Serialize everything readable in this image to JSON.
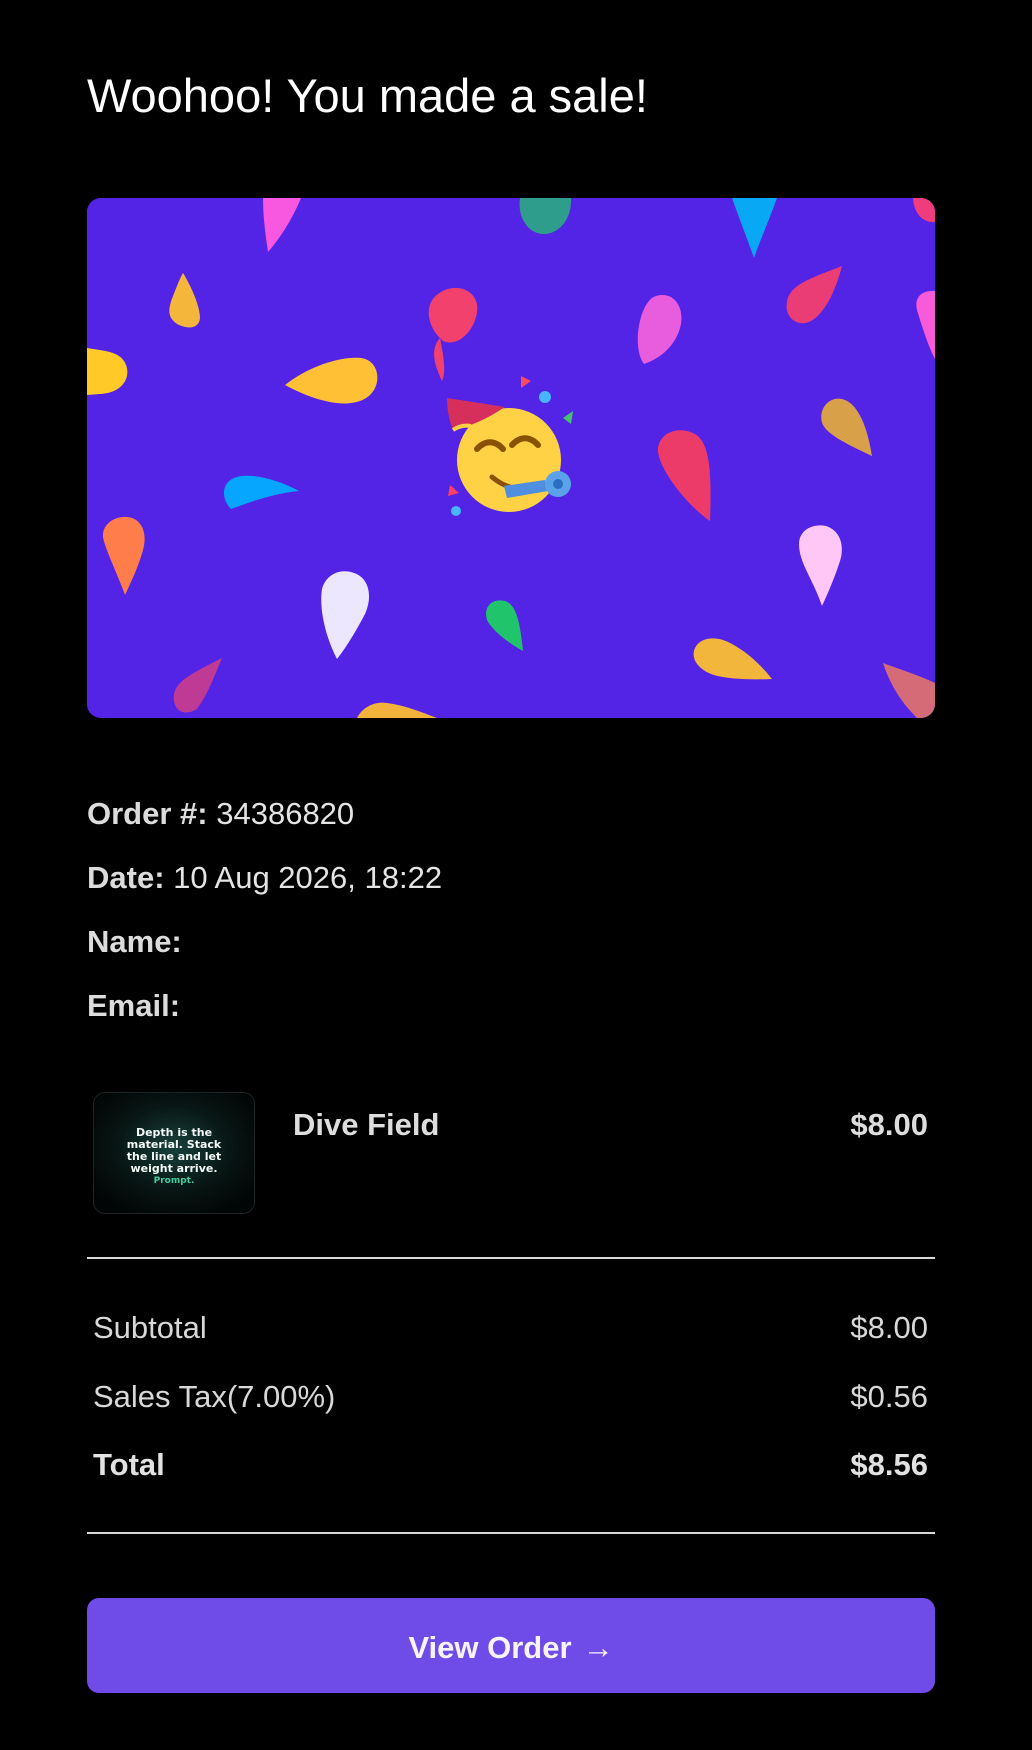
{
  "email": {
    "heading": "Woohoo! You made a sale!",
    "banner": {
      "background_color": "#5324e6",
      "center_icon": "party-face-icon"
    },
    "order": {
      "order_label": "Order #:",
      "order_number": "34386820",
      "date_label": "Date:",
      "date_value": "10 Aug 2026, 18:22",
      "name_label": "Name:",
      "name_value": "",
      "email_label": "Email:",
      "email_value": ""
    },
    "product": {
      "name": "Dive Field",
      "price": "$8.00",
      "thumbnail_text": {
        "line1": "Depth is the",
        "line2": "material. Stack",
        "line3": "the line and let",
        "line4": "weight arrive.",
        "line5": "Prompt."
      }
    },
    "summary": {
      "subtotal_label": "Subtotal",
      "subtotal_value": "$8.00",
      "tax_label": "Sales Tax(7.00%)",
      "tax_value": "$0.56",
      "total_label": "Total",
      "total_value": "$8.56"
    },
    "cta": {
      "label": "View Order",
      "icon": "arrow-right-icon",
      "color": "#6f4be8"
    }
  }
}
